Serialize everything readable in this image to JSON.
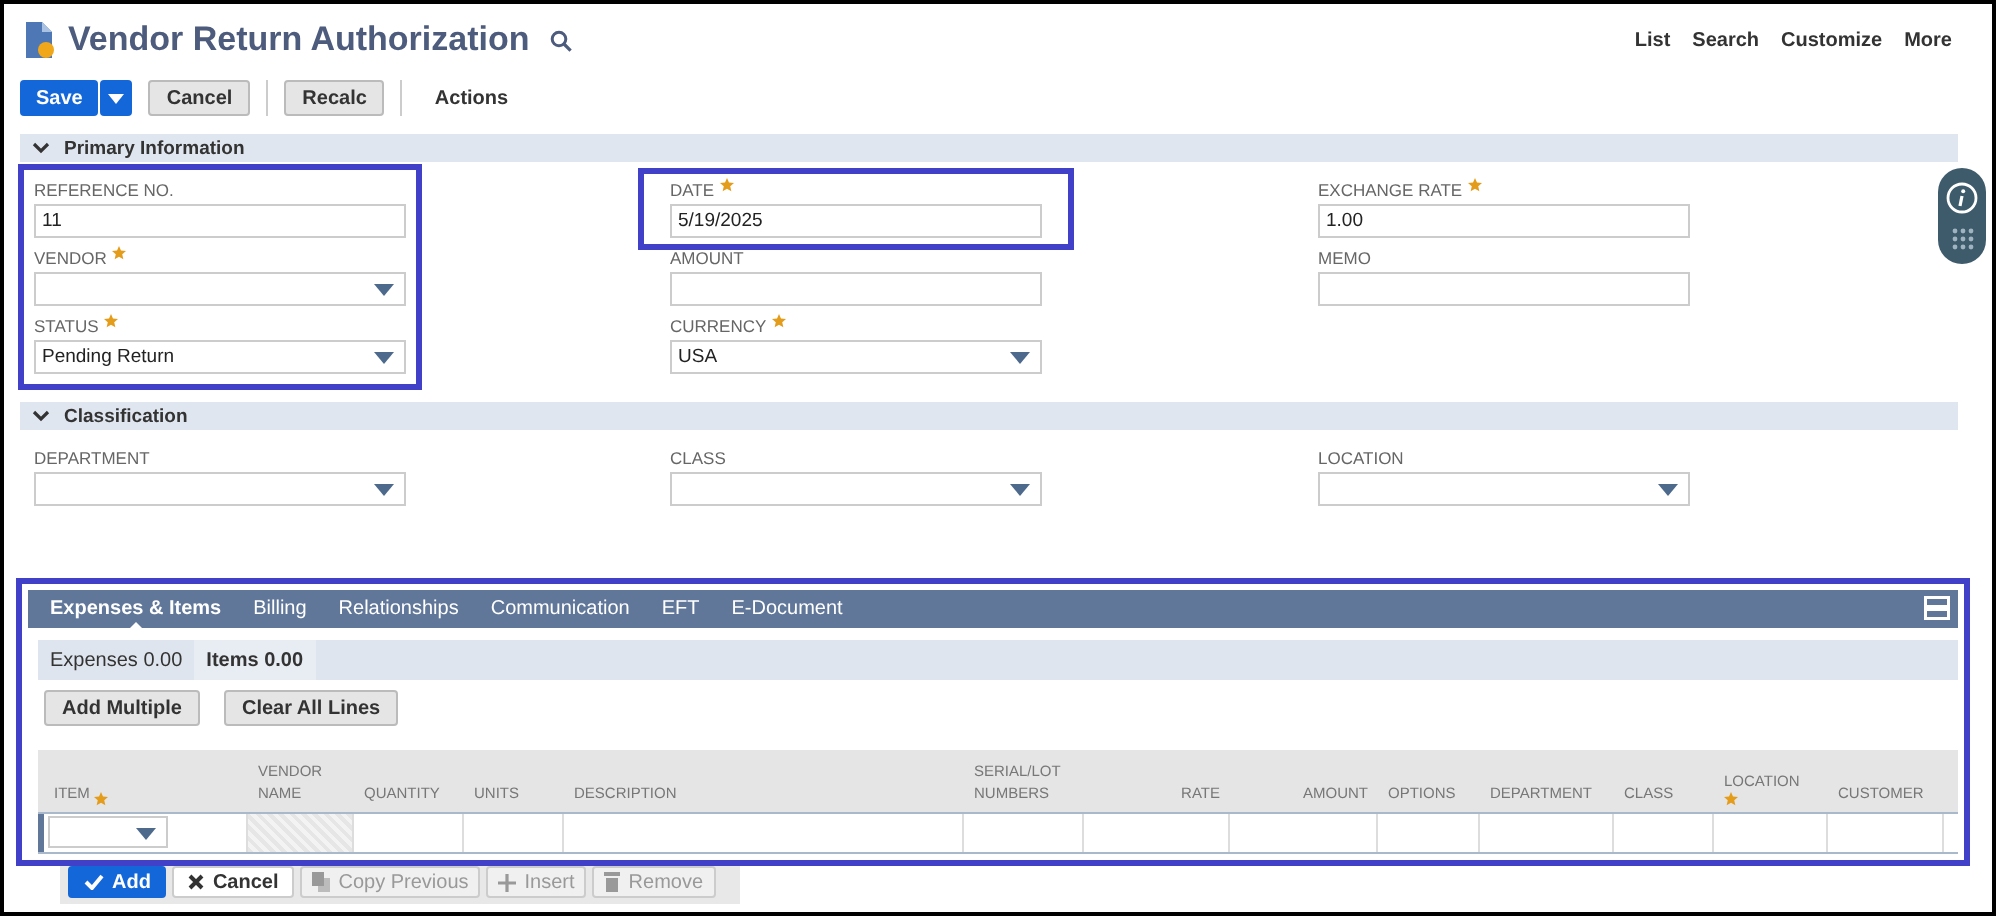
{
  "header": {
    "title": "Vendor Return Authorization",
    "links": [
      "List",
      "Search",
      "Customize",
      "More"
    ]
  },
  "toolbar": {
    "buttons": [
      {
        "label": "Save",
        "kind": "primary"
      },
      {
        "label": "Cancel",
        "kind": "secondary"
      },
      {
        "label": "Recalc",
        "kind": "secondary"
      },
      {
        "label": "Actions",
        "kind": "menu"
      }
    ]
  },
  "sections": [
    {
      "title": "Primary Information",
      "expanded": true,
      "columns": [
        {
          "highlighted": true,
          "fields": [
            {
              "label": "REFERENCE NO.",
              "required": false,
              "kind": "text",
              "value": "11",
              "highlighted": false
            },
            {
              "label": "VENDOR",
              "required": true,
              "kind": "select",
              "highlighted": false
            },
            {
              "label": "STATUS",
              "required": true,
              "kind": "select",
              "value": "Pending Return",
              "highlighted": false
            }
          ]
        },
        {
          "highlighted": false,
          "fields": [
            {
              "label": "DATE",
              "required": true,
              "kind": "text",
              "value": "5/19/2025",
              "highlighted": true
            },
            {
              "label": "AMOUNT",
              "required": false,
              "kind": "text",
              "highlighted": false
            },
            {
              "label": "CURRENCY",
              "required": true,
              "kind": "select",
              "value": "USA",
              "highlighted": false
            }
          ]
        },
        {
          "highlighted": false,
          "fields": [
            {
              "label": "EXCHANGE RATE",
              "required": true,
              "kind": "text",
              "value": "1.00",
              "highlighted": false
            },
            {
              "label": "MEMO",
              "required": false,
              "kind": "text",
              "highlighted": false
            }
          ]
        }
      ]
    },
    {
      "title": "Classification",
      "expanded": true,
      "columns": [
        {
          "highlighted": false,
          "fields": [
            {
              "label": "DEPARTMENT",
              "required": false,
              "kind": "select",
              "highlighted": false
            }
          ]
        },
        {
          "highlighted": false,
          "fields": [
            {
              "label": "CLASS",
              "required": false,
              "kind": "select",
              "highlighted": false
            }
          ]
        },
        {
          "highlighted": false,
          "fields": [
            {
              "label": "LOCATION",
              "required": false,
              "kind": "select",
              "highlighted": false
            }
          ]
        }
      ]
    }
  ],
  "sublist": {
    "highlighted": true,
    "tabs": [
      {
        "label": "Expenses & Items",
        "selected": true
      },
      {
        "label": "Billing",
        "selected": false
      },
      {
        "label": "Relationships",
        "selected": false
      },
      {
        "label": "Communication",
        "selected": false
      },
      {
        "label": "EFT",
        "selected": false
      },
      {
        "label": "E-Document",
        "selected": false
      }
    ],
    "subtabs": [
      {
        "label": "Expenses 0.00",
        "selected": false
      },
      {
        "label": "Items 0.00",
        "selected": true
      }
    ],
    "buttons": [
      "Add Multiple",
      "Clear All Lines"
    ],
    "columns": [
      {
        "label": "ITEM",
        "required": true
      },
      {
        "label": "VENDOR NAME",
        "required": false
      },
      {
        "label": "QUANTITY",
        "required": false
      },
      {
        "label": "UNITS",
        "required": false
      },
      {
        "label": "DESCRIPTION",
        "required": false
      },
      {
        "label": "SERIAL/LOT NUMBERS",
        "required": false
      },
      {
        "label": "RATE",
        "required": false
      },
      {
        "label": "AMOUNT",
        "required": false
      },
      {
        "label": "OPTIONS",
        "required": false
      },
      {
        "label": "DEPARTMENT",
        "required": false
      },
      {
        "label": "CLASS",
        "required": false
      },
      {
        "label": "LOCATION",
        "required": true
      },
      {
        "label": "CUSTOMER",
        "required": false
      }
    ],
    "line_buttons": [
      {
        "label": "Add",
        "kind": "primary",
        "disabled": false
      },
      {
        "label": "Cancel",
        "kind": "secondary",
        "disabled": false
      },
      {
        "label": "Copy Previous",
        "kind": "secondary",
        "disabled": true
      },
      {
        "label": "Insert",
        "kind": "secondary",
        "disabled": true
      },
      {
        "label": "Remove",
        "kind": "secondary",
        "disabled": true
      }
    ]
  }
}
